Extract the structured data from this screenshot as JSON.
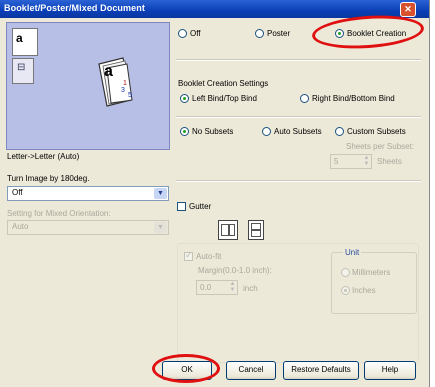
{
  "window": {
    "title": "Booklet/Poster/Mixed Document"
  },
  "preview": {
    "caption": "Letter->Letter (Auto)",
    "page_glyph": "a",
    "page_numbers": [
      "1",
      "3",
      "5"
    ]
  },
  "rotate": {
    "label": "Turn Image by 180deg.",
    "value": "Off"
  },
  "mixed": {
    "label": "Setting for Mixed Orientation:",
    "value": "Auto"
  },
  "mode": {
    "off": "Off",
    "poster": "Poster",
    "booklet": "Booklet Creation",
    "selected": "booklet"
  },
  "booklet_settings": {
    "heading": "Booklet Creation Settings",
    "bind_left": "Left Bind/Top Bind",
    "bind_right": "Right Bind/Bottom Bind",
    "no_subsets": "No Subsets",
    "auto_subsets": "Auto Subsets",
    "custom_subsets": "Custom Subsets",
    "sheets_per_subset_label": "Sheets per Subset:",
    "sheets_value": "5",
    "sheets_unit": "Sheets"
  },
  "gutter": {
    "label": "Gutter",
    "auto_fit": "Auto-fit",
    "margin_label": "Margin(0.0-1.0 inch):",
    "margin_value": "0.0",
    "margin_unit": "inch",
    "unit_label": "Unit",
    "millimeters": "Millimeters",
    "inches": "Inches"
  },
  "buttons": {
    "ok": "OK",
    "cancel": "Cancel",
    "restore": "Restore Defaults",
    "help": "Help"
  },
  "colors": {
    "titlebar": "#0b3fb7",
    "dialog": "#ece9d8",
    "highlight_oval": "#e01010",
    "preview_bg": "#b8bfe6"
  },
  "icons": [
    "close-icon",
    "preview-page-a-icon",
    "preview-staple-icon",
    "booklet-preview-icon",
    "gutter-layout-icon",
    "gutter-layout-alt-icon",
    "spin-arrows-icon",
    "chevron-down-icon"
  ]
}
